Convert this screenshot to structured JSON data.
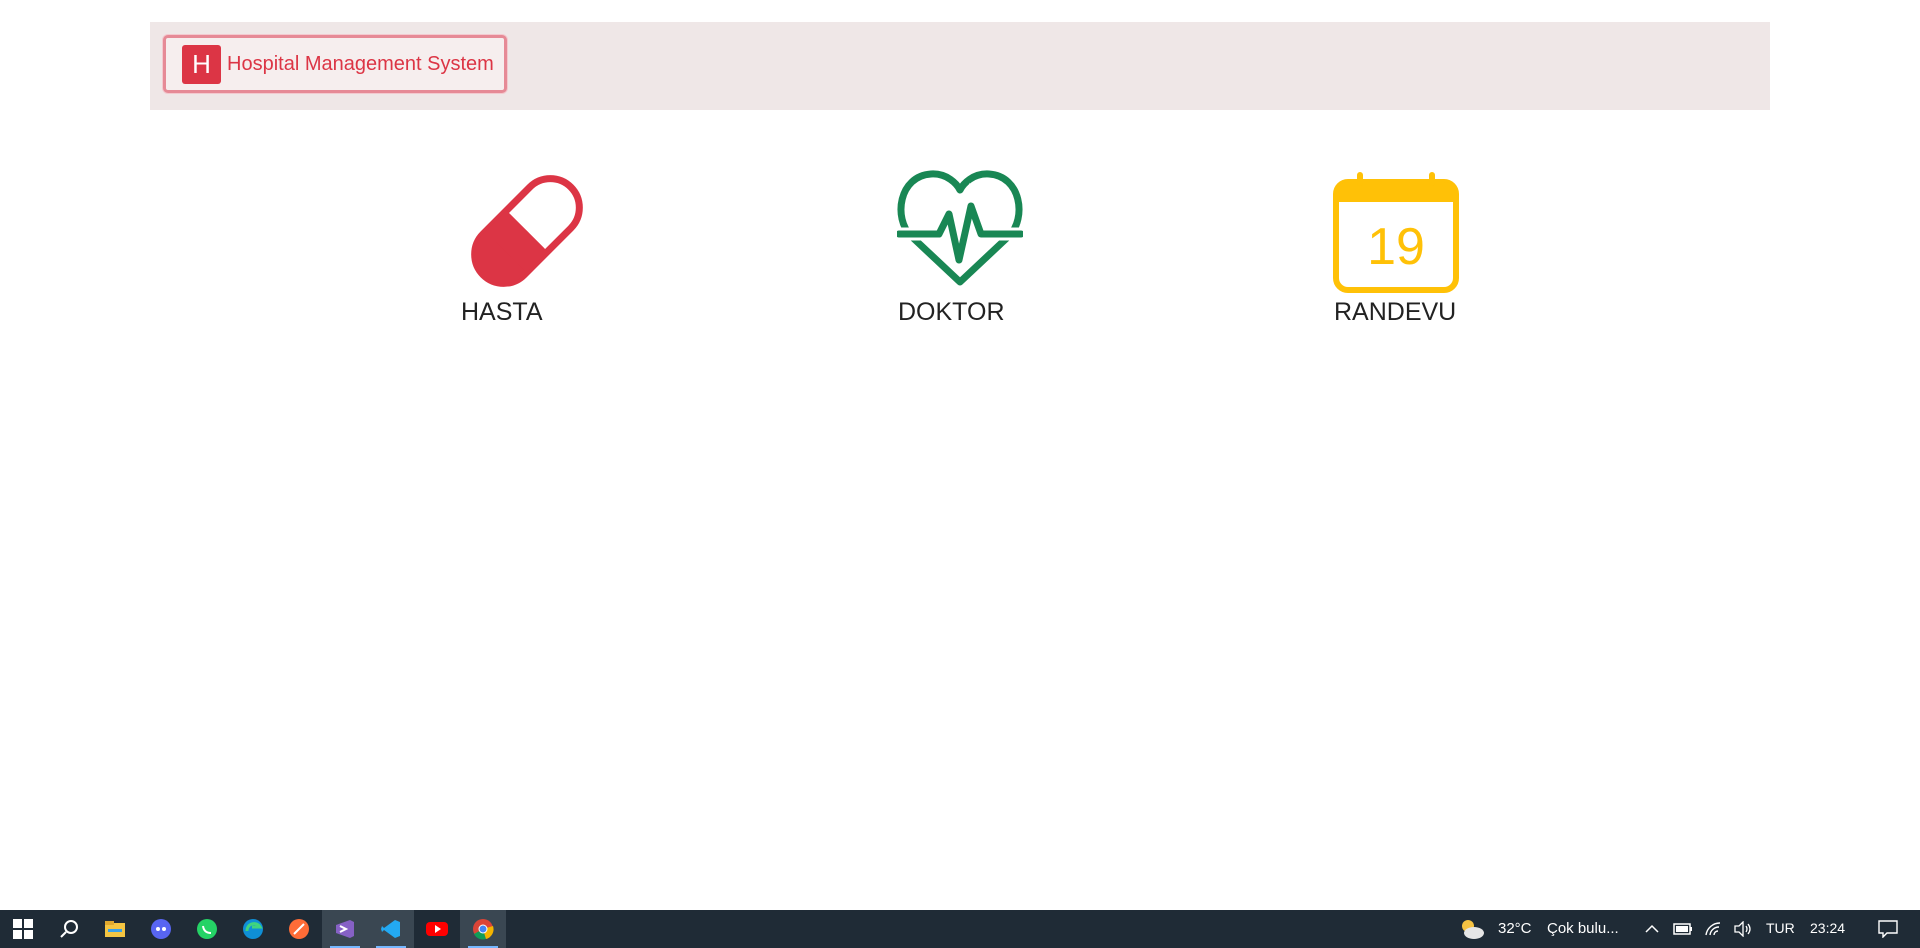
{
  "navbar": {
    "brand_letter": "H",
    "brand_title": "Hospital Management System"
  },
  "tiles": [
    {
      "label": "HASTA",
      "icon": "pill-icon",
      "color": "#dc3545"
    },
    {
      "label": "DOKTOR",
      "icon": "heart-pulse-icon",
      "color": "#198754"
    },
    {
      "label": "RANDEVU",
      "icon": "calendar-icon",
      "color": "#ffc107",
      "calendar_day": "19"
    }
  ],
  "taskbar": {
    "apps": [
      "windows-start-icon",
      "search-icon",
      "file-explorer-icon",
      "discord-icon",
      "whatsapp-icon",
      "edge-icon",
      "postman-icon",
      "visual-studio-icon",
      "vscode-icon",
      "youtube-icon",
      "chrome-icon"
    ],
    "weather_temp": "32°C",
    "weather_desc": "Çok bulu...",
    "language": "TUR",
    "time": "23:24"
  }
}
